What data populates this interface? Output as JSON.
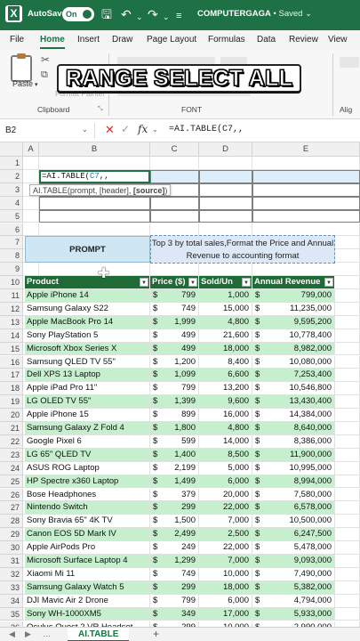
{
  "titlebar": {
    "autosave_label": "AutoSave",
    "toggle_label": "On",
    "document_name": "COMPUTERGAGA",
    "separator": " • ",
    "status": "Saved",
    "status_caret": "⌄"
  },
  "menu": {
    "tabs": [
      "File",
      "Home",
      "Insert",
      "Draw",
      "Page Layout",
      "Formulas",
      "Data",
      "Review",
      "View"
    ],
    "active_index": 1
  },
  "ribbon": {
    "paste_label": "Paste",
    "format_painter_label": "Format Painter",
    "clipboard_group": "Clipboard",
    "font_group": "FONT",
    "alignment_group": "Alig"
  },
  "overlay": {
    "caption": "RANGE SELECT ALL"
  },
  "formula_bar": {
    "name_box": "B2",
    "formula": "=AI.TABLE(C7,,"
  },
  "grid": {
    "columns": [
      "A",
      "B",
      "C",
      "D",
      "E"
    ],
    "row_numbers": [
      "1",
      "2",
      "3",
      "4",
      "5",
      "6",
      "7",
      "8",
      "9",
      "10",
      "11",
      "12",
      "13",
      "14",
      "15",
      "16",
      "17",
      "18",
      "19",
      "20",
      "21",
      "22",
      "23",
      "24",
      "25",
      "26",
      "27",
      "28",
      "29",
      "30",
      "31",
      "32",
      "33",
      "34",
      "35",
      "36"
    ],
    "active_cell_text_prefix": "=AI.TABLE(",
    "active_cell_ref": "C7",
    "active_cell_text_suffix": ",,",
    "tooltip_text": "AI.TABLE(prompt, [header], ",
    "tooltip_bold": "[source]",
    "tooltip_close": ")",
    "prompt_label": "PROMPT",
    "prompt_text": "Top 3 by total sales,Format the Price and Annual Revenue to accounting format"
  },
  "table": {
    "headers": [
      "Product",
      "Price ($)",
      "Sold/Un",
      "Annual Revenue"
    ],
    "rows": [
      [
        "Apple iPhone 14",
        "$",
        "799",
        "1,000",
        "$",
        "799,000"
      ],
      [
        "Samsung Galaxy S22",
        "$",
        "749",
        "15,000",
        "$",
        "11,235,000"
      ],
      [
        "Apple MacBook Pro 14",
        "$",
        "1,999",
        "4,800",
        "$",
        "9,595,200"
      ],
      [
        "Sony PlayStation 5",
        "$",
        "499",
        "21,600",
        "$",
        "10,778,400"
      ],
      [
        "Microsoft Xbox Series X",
        "$",
        "499",
        "18,000",
        "$",
        "8,982,000"
      ],
      [
        "Samsung QLED TV 55\"",
        "$",
        "1,200",
        "8,400",
        "$",
        "10,080,000"
      ],
      [
        "Dell XPS 13 Laptop",
        "$",
        "1,099",
        "6,600",
        "$",
        "7,253,400"
      ],
      [
        "Apple iPad Pro 11\"",
        "$",
        "799",
        "13,200",
        "$",
        "10,546,800"
      ],
      [
        "LG OLED TV 55\"",
        "$",
        "1,399",
        "9,600",
        "$",
        "13,430,400"
      ],
      [
        "Apple iPhone 15",
        "$",
        "899",
        "16,000",
        "$",
        "14,384,000"
      ],
      [
        "Samsung Galaxy Z Fold 4",
        "$",
        "1,800",
        "4,800",
        "$",
        "8,640,000"
      ],
      [
        "Google Pixel 6",
        "$",
        "599",
        "14,000",
        "$",
        "8,386,000"
      ],
      [
        "LG 65\" QLED TV",
        "$",
        "1,400",
        "8,500",
        "$",
        "11,900,000"
      ],
      [
        "ASUS ROG Laptop",
        "$",
        "2,199",
        "5,000",
        "$",
        "10,995,000"
      ],
      [
        "HP Spectre x360 Laptop",
        "$",
        "1,499",
        "6,000",
        "$",
        "8,994,000"
      ],
      [
        "Bose Headphones",
        "$",
        "379",
        "20,000",
        "$",
        "7,580,000"
      ],
      [
        "Nintendo Switch",
        "$",
        "299",
        "22,000",
        "$",
        "6,578,000"
      ],
      [
        "Sony Bravia 65\" 4K TV",
        "$",
        "1,500",
        "7,000",
        "$",
        "10,500,000"
      ],
      [
        "Canon EOS 5D Mark IV",
        "$",
        "2,499",
        "2,500",
        "$",
        "6,247,500"
      ],
      [
        "Apple AirPods Pro",
        "$",
        "249",
        "22,000",
        "$",
        "5,478,000"
      ],
      [
        "Microsoft Surface Laptop 4",
        "$",
        "1,299",
        "7,000",
        "$",
        "9,093,000"
      ],
      [
        "Xiaomi Mi 11",
        "$",
        "749",
        "10,000",
        "$",
        "7,490,000"
      ],
      [
        "Samsung Galaxy Watch 5",
        "$",
        "299",
        "18,000",
        "$",
        "5,382,000"
      ],
      [
        "DJI Mavic Air 2 Drone",
        "$",
        "799",
        "6,000",
        "$",
        "4,794,000"
      ],
      [
        "Sony WH-1000XM5",
        "$",
        "349",
        "17,000",
        "$",
        "5,933,000"
      ],
      [
        "Oculus Quest 2 VR Headset",
        "$",
        "299",
        "10,000",
        "$",
        "2,990,000"
      ]
    ]
  },
  "sheets": {
    "active": "AI.TABLE",
    "add_label": "+"
  },
  "colors": {
    "brand_green": "#1e7145",
    "table_header": "#1e6b36",
    "band_green": "#c6efce",
    "prompt_blue": "#cfe6f3"
  }
}
